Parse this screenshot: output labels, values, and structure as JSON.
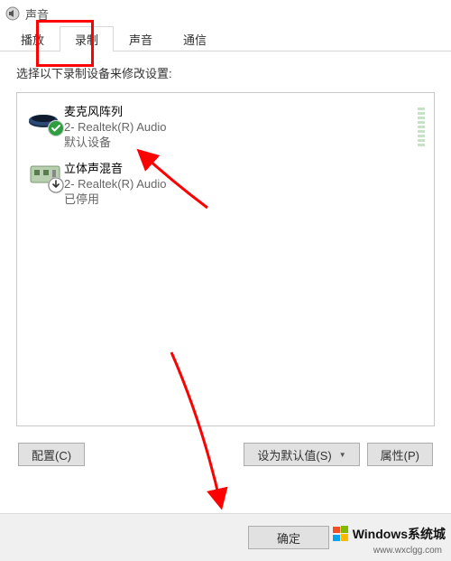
{
  "window": {
    "title": "声音"
  },
  "tabs": {
    "playback": "播放",
    "recording": "录制",
    "sounds": "声音",
    "comm": "通信",
    "active": "recording"
  },
  "prompt": "选择以下录制设备来修改设置:",
  "devices": [
    {
      "name": "麦克风阵列",
      "device": "2- Realtek(R) Audio",
      "status": "默认设备",
      "icon": "mic-array",
      "badge": "check",
      "level_meter": true
    },
    {
      "name": "立体声混音",
      "device": "2- Realtek(R) Audio",
      "status": "已停用",
      "icon": "sound-card",
      "badge": "down",
      "level_meter": false
    }
  ],
  "buttons": {
    "configure": "配置(C)",
    "set_default": "设为默认值(S)",
    "properties": "属性(P)"
  },
  "dialog_buttons": {
    "ok": "确定"
  },
  "watermark": {
    "text": "Windows系统城",
    "url": "www.wxclgg.com"
  }
}
